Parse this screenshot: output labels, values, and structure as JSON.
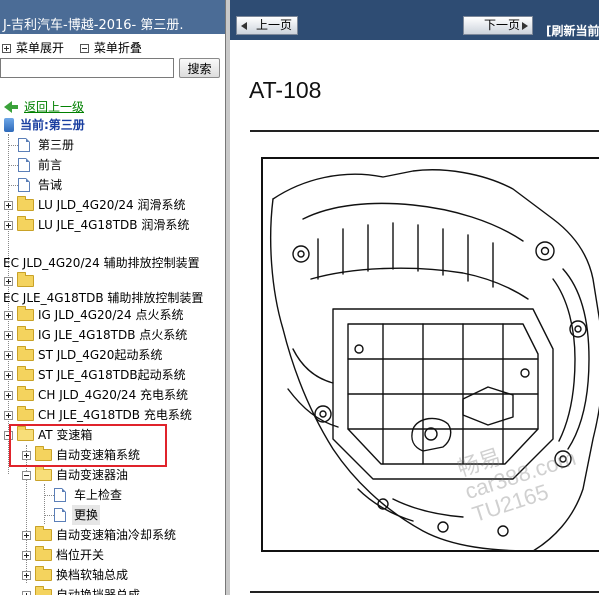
{
  "left_pane": {
    "title": "J-吉利汽车-博越-2016- 第三册.",
    "expand_all": "菜单展开",
    "collapse_all": "菜单折叠",
    "search_placeholder": "",
    "search_button": "搜索",
    "back_link": "返回上一级",
    "current_label": "当前:第三册"
  },
  "tree": [
    {
      "label": "第三册"
    },
    {
      "label": "前言"
    },
    {
      "label": "告诫"
    },
    {
      "label": "LU JLD_4G20/24 润滑系统"
    },
    {
      "label": "LU JLE_4G18TDB 润滑系统"
    },
    {
      "label": "EC JLD_4G20/24 辅助排放控制装置"
    },
    {
      "label": "EC JLE_4G18TDB 辅助排放控制装置"
    },
    {
      "label": "IG JLD_4G20/24 点火系统"
    },
    {
      "label": "IG JLE_4G18TDB 点火系统"
    },
    {
      "label": "ST JLD_4G20起动系统"
    },
    {
      "label": "ST JLE_4G18TDB起动系统"
    },
    {
      "label": "CH JLD_4G20/24 充电系统"
    },
    {
      "label": "CH JLE_4G18TDB 充电系统"
    },
    {
      "label": "AT 变速箱"
    },
    {
      "label": "自动变速箱系统"
    },
    {
      "label": "自动变速器油"
    },
    {
      "label": "车上检查"
    },
    {
      "label": "更换"
    },
    {
      "label": "自动变速箱油冷却系统"
    },
    {
      "label": "档位开关"
    },
    {
      "label": "换档软轴总成"
    },
    {
      "label": "自动换挡器总成"
    }
  ],
  "right_pane": {
    "prev_button": "上一页",
    "next_button": "下一页",
    "refresh_link": "[刷新当前",
    "page_code": "AT-108",
    "watermark_lines": [
      "畅易",
      "car388.com",
      "TU2165"
    ]
  }
}
